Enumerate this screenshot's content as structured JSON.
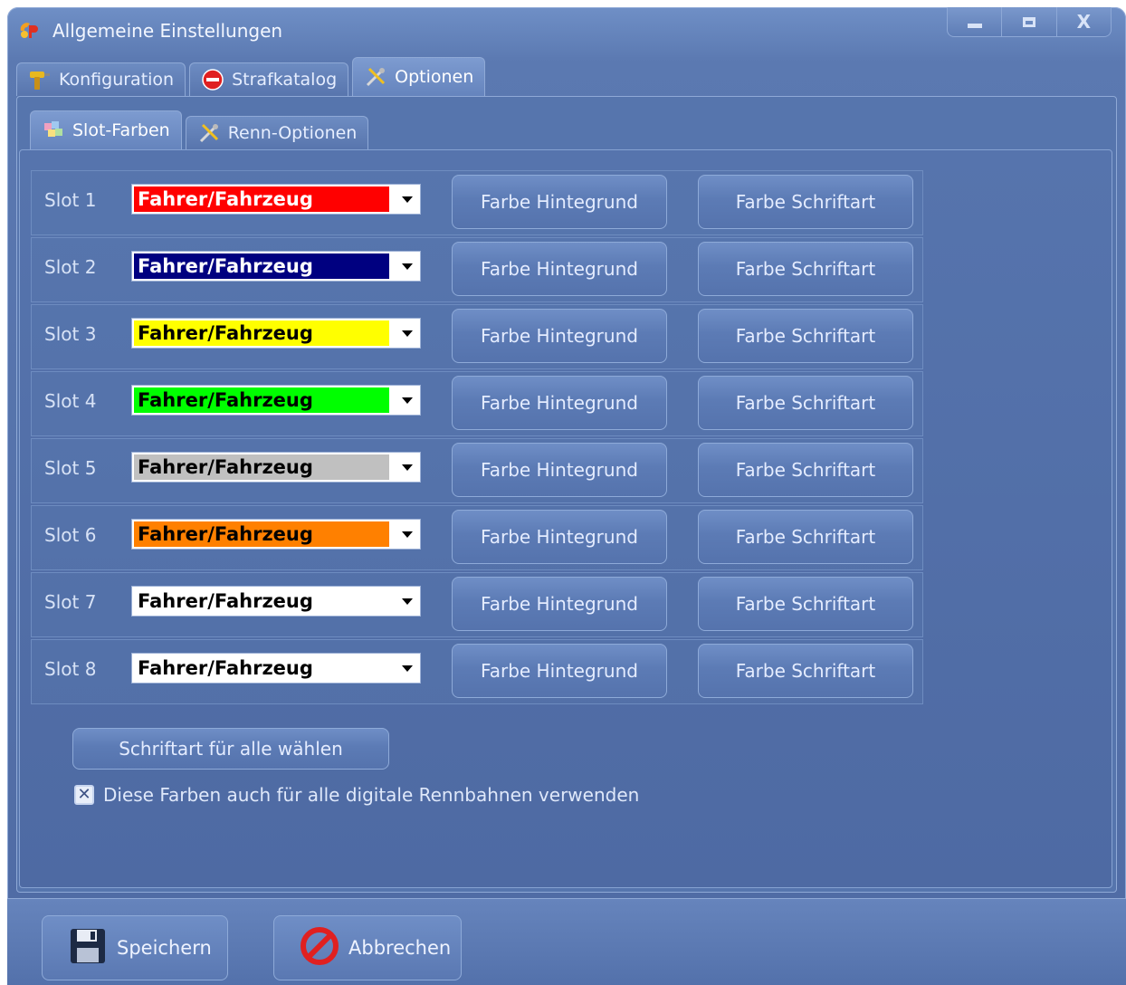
{
  "window": {
    "title": "Allgemeine Einstellungen",
    "controls": {
      "minimize": "minimize",
      "maximize": "maximize",
      "close": "X"
    }
  },
  "tabs": [
    {
      "label": "Konfiguration",
      "icon": "drill-icon",
      "active": false
    },
    {
      "label": "Strafkatalog",
      "icon": "stop-sign-icon",
      "active": false
    },
    {
      "label": "Optionen",
      "icon": "tools-icon",
      "active": true
    }
  ],
  "subtabs": [
    {
      "label": "Slot-Farben",
      "icon": "palette-icon",
      "active": true
    },
    {
      "label": "Renn-Optionen",
      "icon": "tools-icon",
      "active": false
    }
  ],
  "slots": [
    {
      "label": "Slot 1",
      "value": "Fahrer/Fahrzeug",
      "bg": "#ff0000",
      "fg": "#ffffff",
      "btn_bg": "Farbe Hintegrund",
      "btn_font": "Farbe Schriftart"
    },
    {
      "label": "Slot 2",
      "value": "Fahrer/Fahrzeug",
      "bg": "#000080",
      "fg": "#ffffff",
      "btn_bg": "Farbe Hintegrund",
      "btn_font": "Farbe Schriftart"
    },
    {
      "label": "Slot 3",
      "value": "Fahrer/Fahrzeug",
      "bg": "#ffff00",
      "fg": "#000000",
      "btn_bg": "Farbe Hintegrund",
      "btn_font": "Farbe Schriftart"
    },
    {
      "label": "Slot 4",
      "value": "Fahrer/Fahrzeug",
      "bg": "#00ff00",
      "fg": "#000000",
      "btn_bg": "Farbe Hintegrund",
      "btn_font": "Farbe Schriftart"
    },
    {
      "label": "Slot 5",
      "value": "Fahrer/Fahrzeug",
      "bg": "#c0c0c0",
      "fg": "#000000",
      "btn_bg": "Farbe Hintegrund",
      "btn_font": "Farbe Schriftart"
    },
    {
      "label": "Slot 6",
      "value": "Fahrer/Fahrzeug",
      "bg": "#ff8000",
      "fg": "#000000",
      "btn_bg": "Farbe Hintegrund",
      "btn_font": "Farbe Schriftart"
    },
    {
      "label": "Slot 7",
      "value": "Fahrer/Fahrzeug",
      "bg": "#ffffff",
      "fg": "#000000",
      "btn_bg": "Farbe Hintegrund",
      "btn_font": "Farbe Schriftart"
    },
    {
      "label": "Slot 8",
      "value": "Fahrer/Fahrzeug",
      "bg": "#ffffff",
      "fg": "#000000",
      "btn_bg": "Farbe Hintegrund",
      "btn_font": "Farbe Schriftart"
    }
  ],
  "all_font_button": "Schriftart für alle wählen",
  "checkbox": {
    "label": "Diese Farben auch für alle digitale Rennbahnen verwenden",
    "checked": true
  },
  "footer": {
    "save_label": "Speichern",
    "save_icon": "floppy-disk-icon",
    "cancel_label": "Abbrechen",
    "cancel_icon": "no-entry-icon"
  }
}
